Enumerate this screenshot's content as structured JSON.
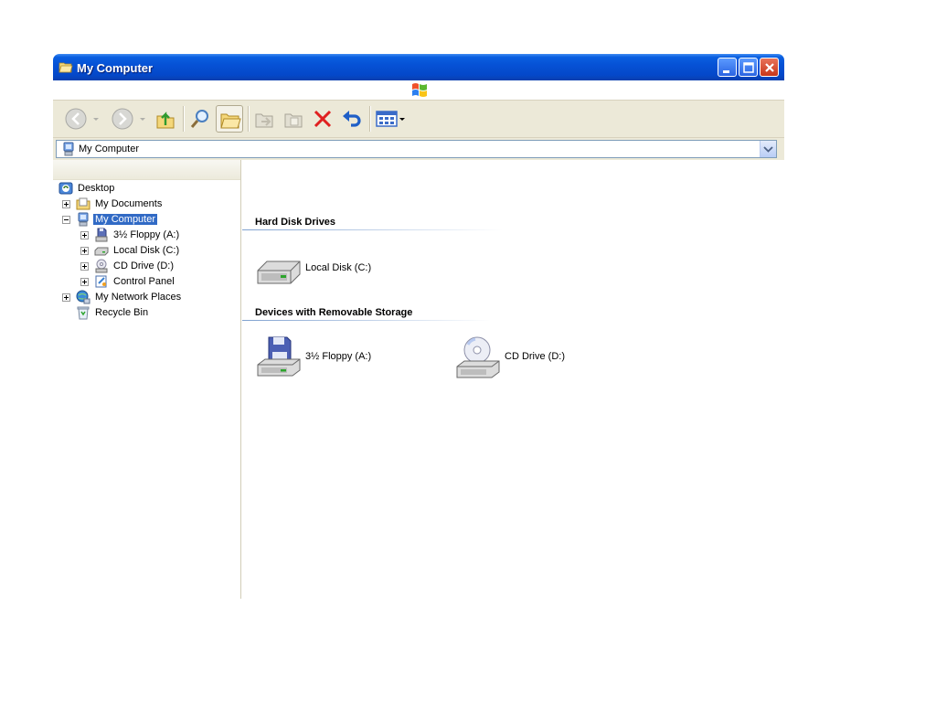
{
  "window": {
    "title": "My Computer"
  },
  "address": {
    "value": "My Computer"
  },
  "tree": {
    "items": [
      {
        "label": "Desktop"
      },
      {
        "label": "My Documents"
      },
      {
        "label": "My Computer"
      },
      {
        "label": "3½ Floppy (A:)"
      },
      {
        "label": "Local Disk (C:)"
      },
      {
        "label": "CD Drive (D:)"
      },
      {
        "label": "Control Panel"
      },
      {
        "label": "My Network Places"
      },
      {
        "label": "Recycle Bin"
      }
    ]
  },
  "content": {
    "groups": [
      {
        "header": "Hard Disk Drives",
        "items": [
          {
            "label": "Local Disk (C:)",
            "icon": "hard-disk-icon"
          }
        ]
      },
      {
        "header": "Devices with Removable Storage",
        "items": [
          {
            "label": "3½ Floppy (A:)",
            "icon": "floppy-drive-icon"
          },
          {
            "label": "CD Drive (D:)",
            "icon": "cd-drive-icon"
          }
        ]
      }
    ]
  },
  "colors": {
    "titlebar": "#0652d6",
    "selection": "#316ac5",
    "toolbar": "#ece9d8",
    "delete_red": "#e02020"
  }
}
